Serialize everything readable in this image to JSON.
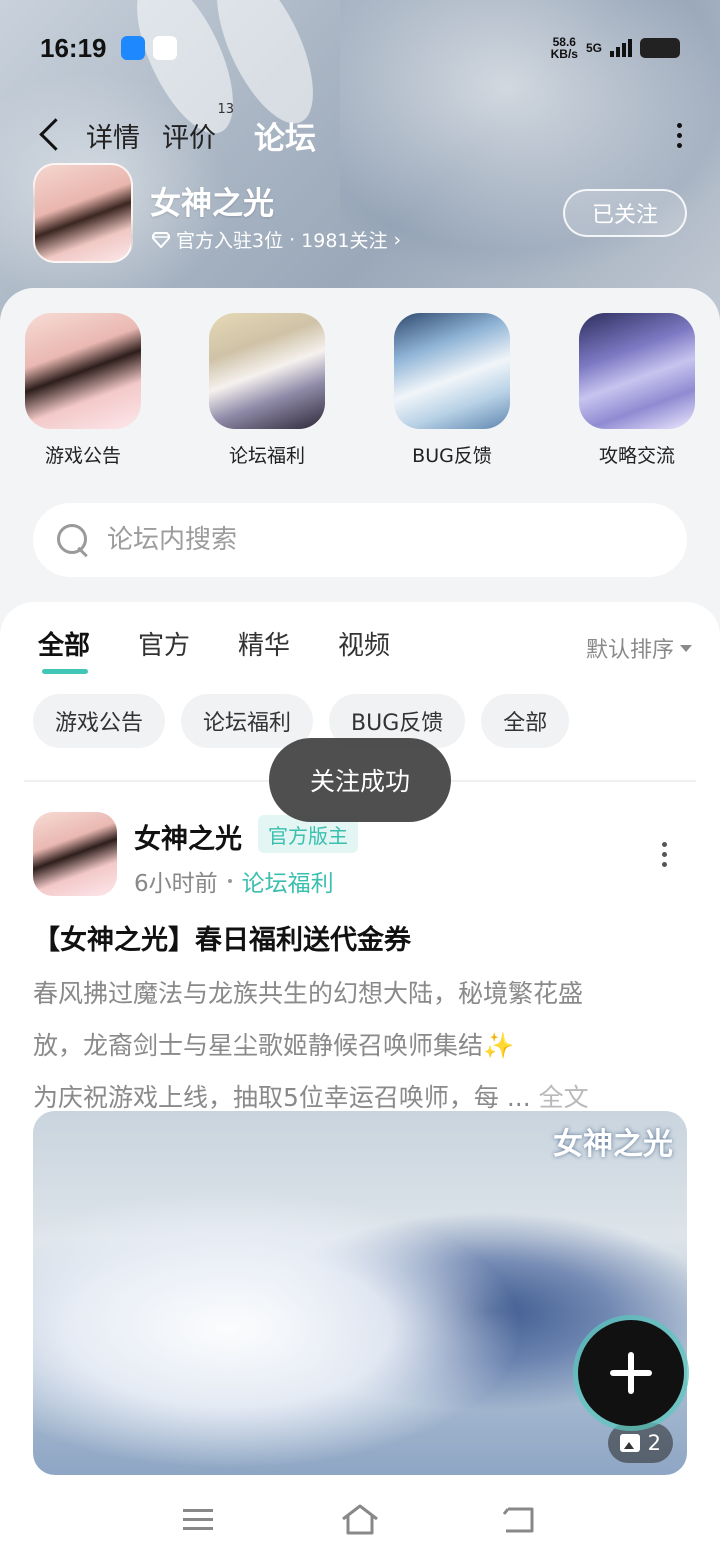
{
  "status_bar": {
    "time": "16:19",
    "net_speed_value": "58.6",
    "net_speed_unit": "KB/s",
    "network": "5G"
  },
  "nav": {
    "tabs": [
      {
        "label": "详情"
      },
      {
        "label": "评价",
        "badge": "13"
      },
      {
        "label": "论坛"
      }
    ],
    "active_tab": "论坛"
  },
  "game": {
    "title": "女神之光",
    "official_count": "官方入驻3位",
    "followers": "1981关注",
    "follow_button": "已关注"
  },
  "categories": [
    {
      "label": "游戏公告"
    },
    {
      "label": "论坛福利"
    },
    {
      "label": "BUG反馈"
    },
    {
      "label": "攻略交流"
    }
  ],
  "search": {
    "placeholder": "论坛内搜索"
  },
  "feed_tabs": [
    {
      "label": "全部"
    },
    {
      "label": "官方"
    },
    {
      "label": "精华"
    },
    {
      "label": "视频"
    }
  ],
  "sort_label": "默认排序",
  "chips": [
    {
      "label": "游戏公告"
    },
    {
      "label": "论坛福利"
    },
    {
      "label": "BUG反馈"
    },
    {
      "label": "全部"
    }
  ],
  "toast": "关注成功",
  "post": {
    "author": "女神之光",
    "badge": "官方版主",
    "time": "6小时前",
    "board": "论坛福利",
    "title": "【女神之光】春日福利送代金券",
    "body_lines": [
      "春风拂过魔法与龙族共生的幻想大陆，秘境繁花盛",
      "放，龙裔剑士与星尘歌姬静候召唤师集结",
      "为庆祝游戏上线，抽取5位幸运召唤师，每 ..."
    ],
    "sparkle": "✨",
    "full_text_link": "全文",
    "image_watermark": "女神之光",
    "image_count": "2"
  },
  "colors": {
    "accent": "#42c6b6",
    "badge_text": "#3bbfae",
    "toast_bg": "#3c3c3c"
  }
}
